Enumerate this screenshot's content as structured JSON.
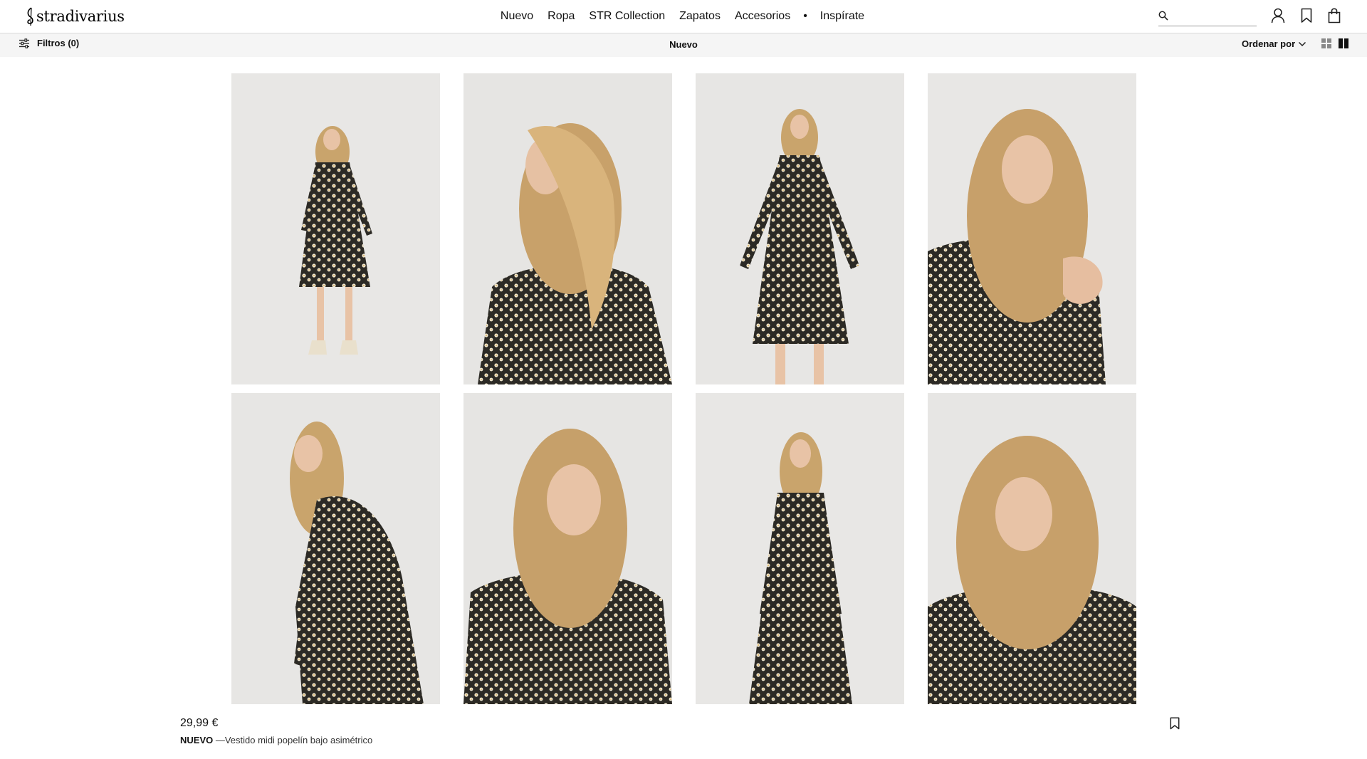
{
  "header": {
    "logo_text": "stradivarius",
    "nav": [
      {
        "label": "Nuevo"
      },
      {
        "label": "Ropa"
      },
      {
        "label": "STR Collection"
      },
      {
        "label": "Zapatos"
      },
      {
        "label": "Accesorios"
      },
      {
        "label": "•"
      },
      {
        "label": "Inspírate"
      }
    ],
    "search": {
      "placeholder": "",
      "value": ""
    },
    "icons": [
      "search-icon",
      "user-icon",
      "wishlist-icon",
      "shopping-bag-icon"
    ]
  },
  "toolbar": {
    "filters_label": "Filtros (0)",
    "section_title": "Nuevo",
    "sort_label": "Ordenar por",
    "view_options": [
      "grid-view-icon",
      "two-column-view-icon"
    ]
  },
  "gallery": {
    "photos": [
      {
        "alt": "Modelo con vestido de flores, cuerpo entero"
      },
      {
        "alt": "Modelo con vestido de flores, perfil con pelo al viento"
      },
      {
        "alt": "Modelo con vestido de flores, de frente"
      },
      {
        "alt": "Modelo con vestido de flores, primer plano"
      },
      {
        "alt": "Modelo con vestido de flores, de lado"
      },
      {
        "alt": "Modelo con vestido de flores, retrato"
      },
      {
        "alt": "Modelo con vestido de flores, de frente sentada"
      },
      {
        "alt": "Modelo con vestido de flores, ojos cerrados"
      }
    ]
  },
  "product": {
    "price": "29,99 €",
    "tag": "NUEVO",
    "name": " —Vestido midi popelín bajo asimétrico"
  },
  "colors": {
    "background": "#ffffff",
    "subbar": "#f5f5f5",
    "photo_bg": "#e9e8e6",
    "dress_base": "#2c2a25",
    "dress_flower": "#efe6cf",
    "hair": "#c7a06a",
    "skin": "#e8c3a6"
  }
}
